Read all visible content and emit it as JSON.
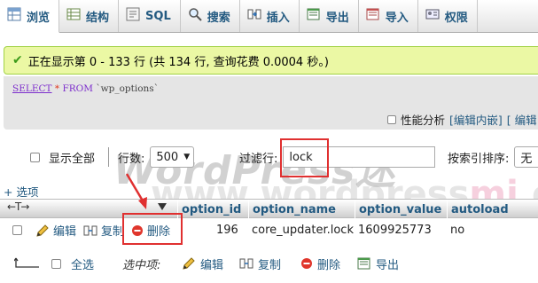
{
  "tabs": [
    {
      "label": "浏览",
      "icon": "browse-icon",
      "active": true
    },
    {
      "label": "结构",
      "icon": "structure-icon"
    },
    {
      "label": "SQL",
      "icon": "sql-icon"
    },
    {
      "label": "搜索",
      "icon": "search-icon"
    },
    {
      "label": "插入",
      "icon": "insert-icon"
    },
    {
      "label": "导出",
      "icon": "export-icon"
    },
    {
      "label": "导入",
      "icon": "import-icon"
    },
    {
      "label": "权限",
      "icon": "privileges-icon"
    }
  ],
  "message": {
    "text": "正在显示第 0 - 133 行 (共 134 行, 查询花费 0.0004 秒。)"
  },
  "sql": {
    "select": "SELECT",
    "star": "*",
    "from": "FROM",
    "table": "`wp_options`"
  },
  "sql_links": {
    "profiling_label": "性能分析",
    "edit_inline": "[编辑内嵌]",
    "edit": "[ 编辑"
  },
  "filter": {
    "show_all_label": "显示全部",
    "rows_label": "行数:",
    "rows_value": "500",
    "filter_label": "过滤行:",
    "filter_value": "lock",
    "sort_label": "按索引排序:",
    "sort_value": "无"
  },
  "options_link": "+ 选项",
  "table": {
    "columns": [
      "option_id",
      "option_name",
      "option_value",
      "autoload"
    ],
    "rows": [
      {
        "edit": "编辑",
        "copy": "复制",
        "delete": "删除",
        "option_id": "196",
        "option_name": "core_updater.lock",
        "option_value": "1609925773",
        "autoload": "no"
      }
    ]
  },
  "bottom_actions": {
    "select_all": "全选",
    "with_selected": "选中项:",
    "edit": "编辑",
    "copy": "复制",
    "delete": "删除",
    "export": "导出"
  },
  "watermark": {
    "line1": "WordPress迷",
    "line2_a": "www.wordpress",
    "line2_b": "mi",
    "line2_c": ".com"
  },
  "colors": {
    "link": "#235a81",
    "success_bg": "#ebf8a4",
    "annotation_red": "#e03030"
  }
}
